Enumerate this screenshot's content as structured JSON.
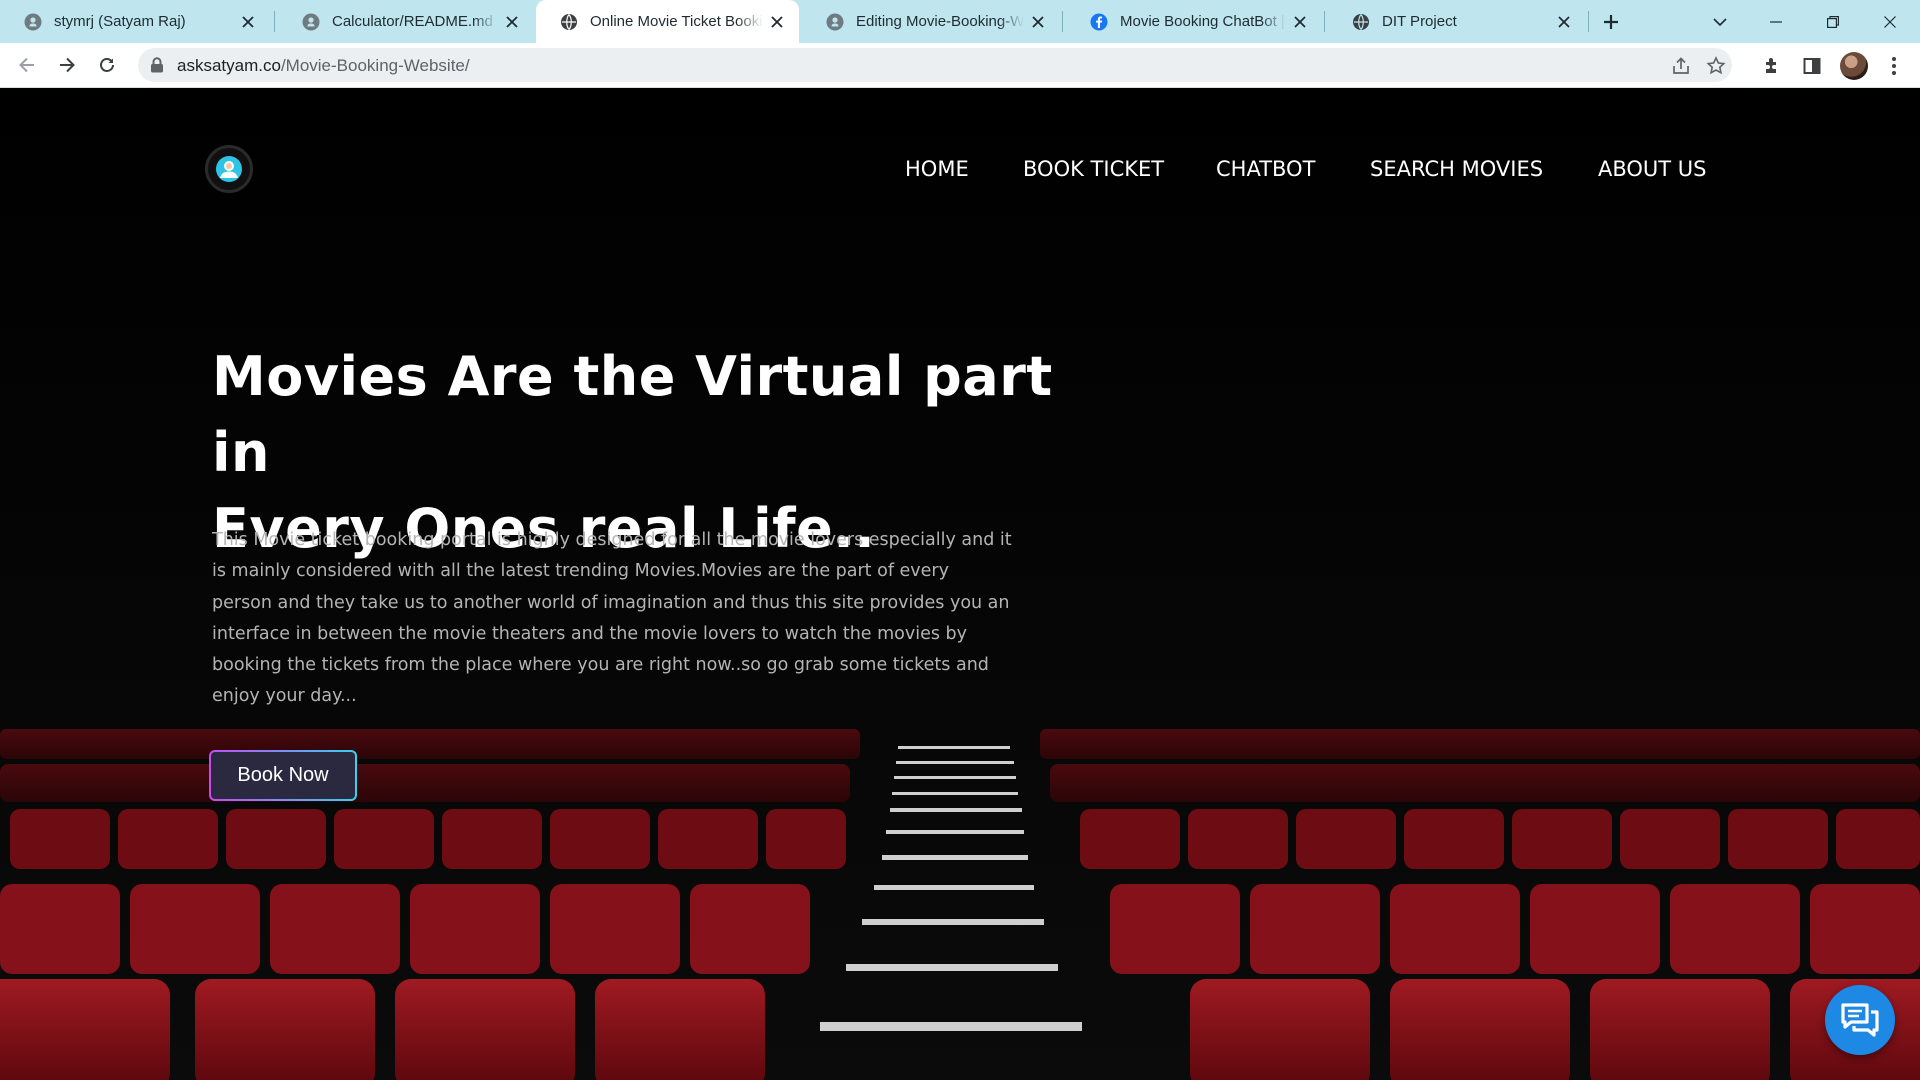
{
  "browser": {
    "tabs": [
      {
        "title": "stymrj (Satyam Raj)",
        "icon": "github-icon",
        "active": false
      },
      {
        "title": "Calculator/README.md at main",
        "icon": "github-icon",
        "active": false
      },
      {
        "title": "Online Movie Ticket Booking",
        "icon": "globe-icon",
        "active": true
      },
      {
        "title": "Editing Movie-Booking-Website",
        "icon": "github-icon",
        "active": false
      },
      {
        "title": "Movie Booking ChatBot | Dialogflow",
        "icon": "facebook-icon",
        "active": false
      },
      {
        "title": "DIT Project",
        "icon": "globe-icon",
        "active": false
      }
    ],
    "url_host": "asksatyam.co",
    "url_path": "/Movie-Booking-Website/"
  },
  "site": {
    "nav": [
      "HOME",
      "BOOK TICKET",
      "CHATBOT",
      "SEARCH MOVIES",
      "ABOUT US"
    ],
    "hero": {
      "title_line1": "Movies Are the Virtual part in",
      "title_line2": "Every Ones real Life..",
      "description": "This Movie ticket booking portal is highly designed for all the movie lovers especially and it is mainly considered with all the latest trending Movies.Movies are the part of every person and they take us to another world of imagination and thus this site provides you an interface in between the movie theaters and the movie lovers to watch the movies by booking the tickets from the place where you are right now..so go grab some tickets and enjoy your day...",
      "button_label": "Book Now"
    }
  },
  "colors": {
    "tabstrip": "#bfe6ef",
    "seat_red": "#8e0d14",
    "chat_button": "#1e88e5",
    "button_border_start": "#c54cf0",
    "button_border_end": "#36d1f3"
  }
}
